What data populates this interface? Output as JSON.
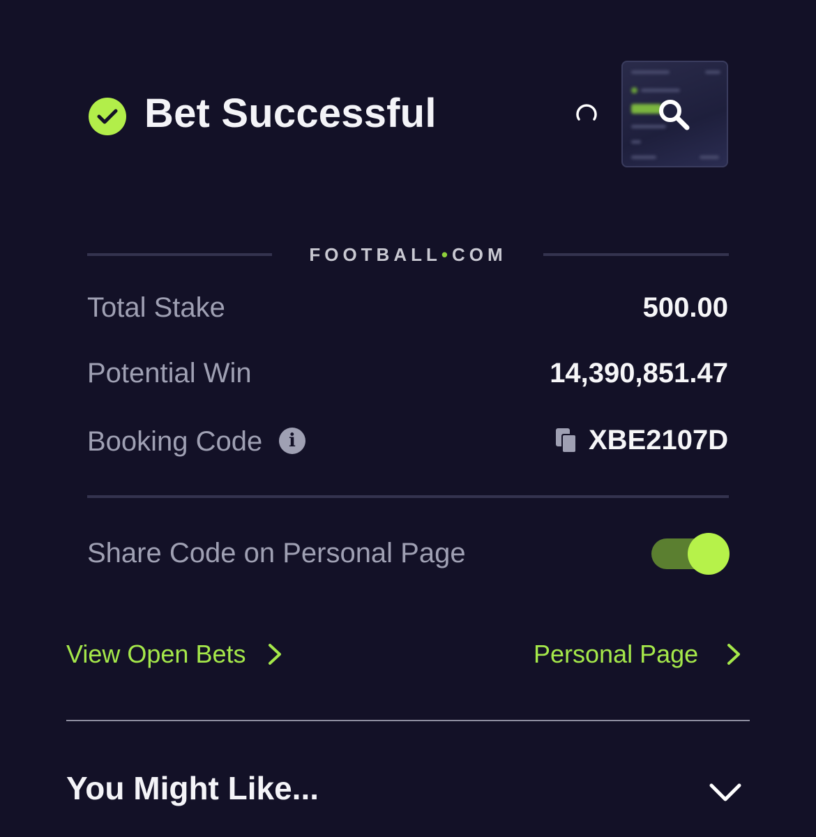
{
  "header": {
    "title": "Bet Successful"
  },
  "brand": {
    "name_left": "FOOTBALL",
    "name_dot": "•",
    "name_right": "COM"
  },
  "details": {
    "total_stake_label": "Total Stake",
    "total_stake_value": "500.00",
    "potential_win_label": "Potential Win",
    "potential_win_value": "14,390,851.47",
    "booking_code_label": "Booking Code",
    "booking_code_value": "XBE2107D"
  },
  "share": {
    "label": "Share Code on Personal Page",
    "enabled": true
  },
  "links": {
    "view_open_bets": "View Open Bets",
    "personal_page": "Personal Page"
  },
  "recommendations": {
    "title": "You Might Like..."
  },
  "colors": {
    "background": "#131127",
    "accent": "#b2ee4a",
    "muted_text": "#9fa0b3",
    "divider": "#34334f"
  },
  "icons": {
    "success": "check-circle-icon",
    "loading": "spinner-icon",
    "preview": "magnifier-icon",
    "info": "info-icon",
    "copy": "copy-icon",
    "forward": "chevron-right-icon",
    "expand": "chevron-down-icon"
  }
}
